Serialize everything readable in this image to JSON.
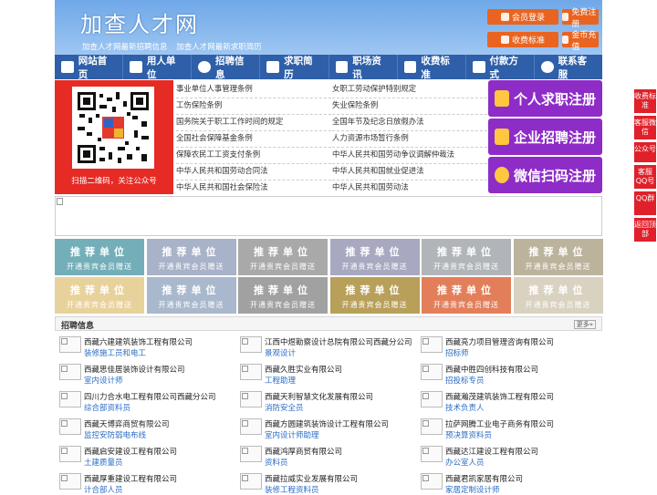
{
  "site": {
    "title": "加查人才网",
    "subtitles": [
      "加查人才网最新招聘信息",
      "加查人才网最新求职简历"
    ]
  },
  "header_buttons": [
    {
      "label": "会员登录",
      "icon": "user-icon"
    },
    {
      "label": "免费注册",
      "icon": "register-icon"
    },
    {
      "label": "收费标准",
      "icon": "price-icon"
    },
    {
      "label": "金币充值",
      "icon": "coin-icon"
    }
  ],
  "nav": [
    {
      "label": "网站首页",
      "icon": "home-icon"
    },
    {
      "label": "用人单位",
      "icon": "building-icon"
    },
    {
      "label": "招聘信息",
      "icon": "chat-icon"
    },
    {
      "label": "求职简历",
      "icon": "resume-icon"
    },
    {
      "label": "职场资讯",
      "icon": "news-icon"
    },
    {
      "label": "收费标准",
      "icon": "list-icon"
    },
    {
      "label": "付款方式",
      "icon": "card-icon"
    },
    {
      "label": "联系客服",
      "icon": "phone-icon"
    }
  ],
  "qr": {
    "caption": "扫描二维码，关注公众号"
  },
  "links_left": [
    "事业单位人事管理条例",
    "工伤保险条例",
    "国务院关于职工工作时间的规定",
    "全国社会保障基金条例",
    "保障农民工工资支付条例",
    "中华人民共和国劳动合同法",
    "中华人民共和国社会保险法"
  ],
  "links_right": [
    "女职工劳动保护特别规定",
    "失业保险条例",
    "全国年节及纪念日放假办法",
    "人力资源市场暂行条例",
    "中华人民共和国劳动争议调解仲裁法",
    "中华人民共和国就业促进法",
    "中华人民共和国劳动法"
  ],
  "register": [
    {
      "label": "个人求职注册",
      "icon": "person-icon"
    },
    {
      "label": "企业招聘注册",
      "icon": "company-icon"
    },
    {
      "label": "微信扫码注册",
      "icon": "wechat-icon"
    }
  ],
  "ads": {
    "title": "推荐单位",
    "sub": "开通贵宾会员赠送",
    "colors": [
      "#74aeb8",
      "#a8b2c8",
      "#a9a9a9",
      "#a8a8c0",
      "#b1b5ba",
      "#bbb39c",
      "#e8d29c",
      "#a9b8cc",
      "#a1a1a1",
      "#b8a05a",
      "#e27f5a",
      "#d9d2c0"
    ]
  },
  "jobs_section": {
    "title": "招聘信息",
    "more": "更多»"
  },
  "jobs": [
    {
      "company": "西藏六建建筑装饰工程有限公司",
      "position": "装修施工员和电工"
    },
    {
      "company": "江西中煜勘察设计总院有限公司西藏分公司",
      "position": "景观设计"
    },
    {
      "company": "西藏亮力项目管理咨询有限公司",
      "position": "招标师"
    },
    {
      "company": "西藏思佳居装饰设计有限公司",
      "position": "室内设计师"
    },
    {
      "company": "西藏久胜实业有限公司",
      "position": "工程助理"
    },
    {
      "company": "西藏中胜四创科技有限公司",
      "position": "招投标专员"
    },
    {
      "company": "四川力合水电工程有限公司西藏分公司",
      "position": "综合部资料员"
    },
    {
      "company": "西藏天利智慧文化发展有限公司",
      "position": "消防安全员"
    },
    {
      "company": "西藏瀚茂建筑装饰工程有限公司",
      "position": "技术负责人"
    },
    {
      "company": "西藏天博弈商贸有限公司",
      "position": "监控安防弱电布线"
    },
    {
      "company": "西藏方圆建筑装饰设计工程有限公司",
      "position": "室内设计师助理"
    },
    {
      "company": "拉萨网腾工业电子商务有限公司",
      "position": "预决算资料员"
    },
    {
      "company": "西藏启安建设工程有限公司",
      "position": "土建质量员"
    },
    {
      "company": "西藏鸿厚商贸有限公司",
      "position": "资料员"
    },
    {
      "company": "西藏达江建设工程有限公司",
      "position": "办公室人员"
    },
    {
      "company": "西藏厚重建设工程有限公司",
      "position": "计合部人员"
    },
    {
      "company": "西藏拉威实业发展有限公司",
      "position": "装修工程资料员"
    },
    {
      "company": "西藏君凯家居有限公司",
      "position": "家居定制设计师"
    }
  ],
  "sidebar": [
    "收费标准",
    "客服微信",
    "公众号",
    "客服QQ号",
    "QQ群",
    "返回顶部"
  ]
}
